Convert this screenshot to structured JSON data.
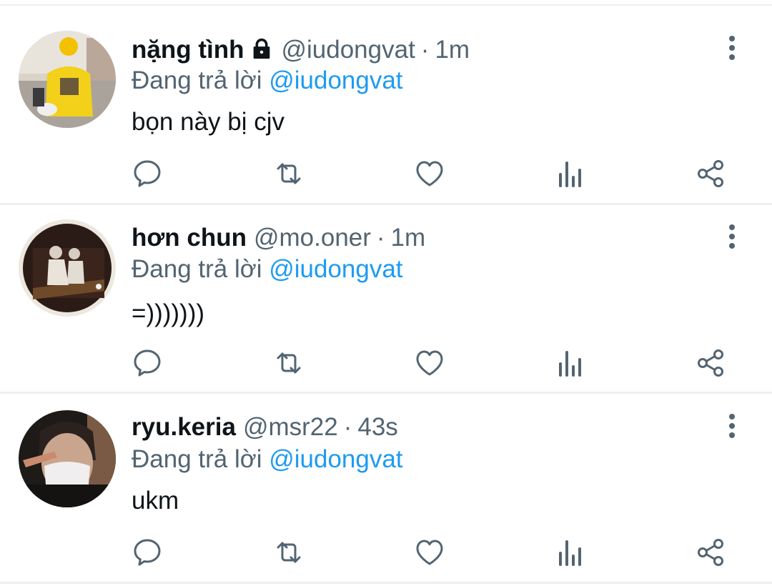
{
  "tweets": [
    {
      "name": "nặng tình",
      "locked": true,
      "handle": "@iudongvat",
      "separator": "·",
      "time": "1m",
      "replying_prefix": "Đang trả lời",
      "replying_to": "@iudongvat",
      "text": "bọn này bị cjv",
      "avatar": "avatar-motorbike-yellow-shirt"
    },
    {
      "name": "hơn chun",
      "locked": false,
      "handle": "@mo.oner",
      "separator": "·",
      "time": "1m",
      "replying_prefix": "Đang trả lời",
      "replying_to": "@iudongvat",
      "text": "=)))))))",
      "avatar": "avatar-billiards"
    },
    {
      "name": "ryu.keria",
      "locked": false,
      "handle": "@msr22",
      "separator": "·",
      "time": "43s",
      "replying_prefix": "Đang trả lời",
      "replying_to": "@iudongvat",
      "text": "ukm",
      "avatar": "avatar-masked-selfie"
    }
  ],
  "actions": [
    "reply-icon",
    "retweet-icon",
    "like-icon",
    "analytics-icon",
    "share-icon"
  ],
  "colors": {
    "text": "#0f1419",
    "secondary": "#536471",
    "link": "#1d9bf0",
    "icon": "#536471",
    "divider": "#eceff1"
  }
}
